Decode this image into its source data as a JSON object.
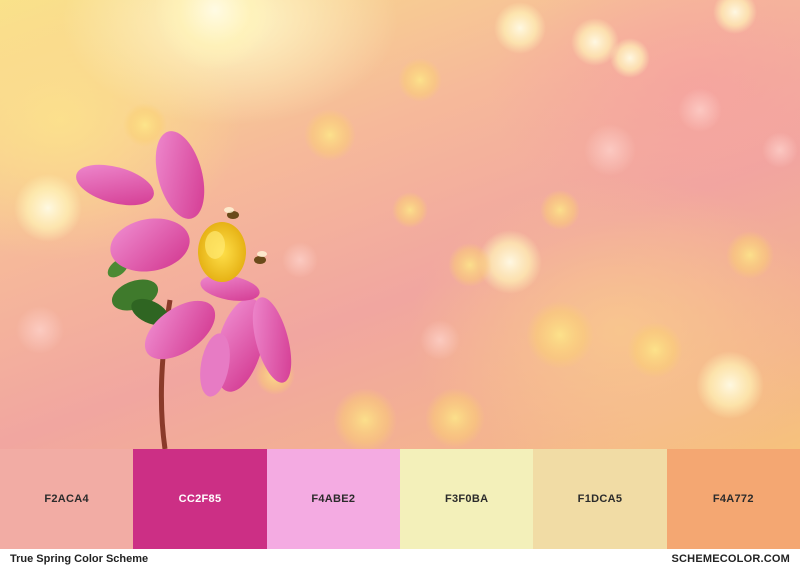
{
  "scheme_title": "True Spring Color Scheme",
  "brand": "SCHEMECOLOR.COM",
  "swatches": [
    {
      "code": "F2ACA4",
      "color": "#F2ACA4"
    },
    {
      "code": "CC2F85",
      "color": "#CC2F85"
    },
    {
      "code": "F4ABE2",
      "color": "#F4ABE2"
    },
    {
      "code": "F3F0BA",
      "color": "#F3F0BA"
    },
    {
      "code": "F1DCA5",
      "color": "#F1DCA5"
    },
    {
      "code": "F4A772",
      "color": "#F4A772"
    }
  ]
}
